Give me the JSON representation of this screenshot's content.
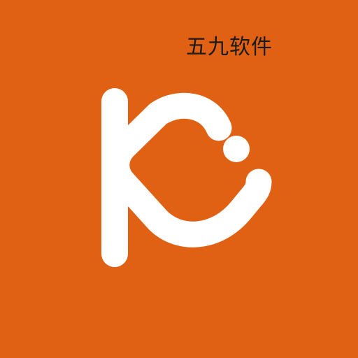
{
  "brand": {
    "name": "五九软件",
    "background_color": "#E06114",
    "logo_color": "#FFFFFF",
    "logo_glyph": "K",
    "logo_icon": "k-logo-icon"
  }
}
